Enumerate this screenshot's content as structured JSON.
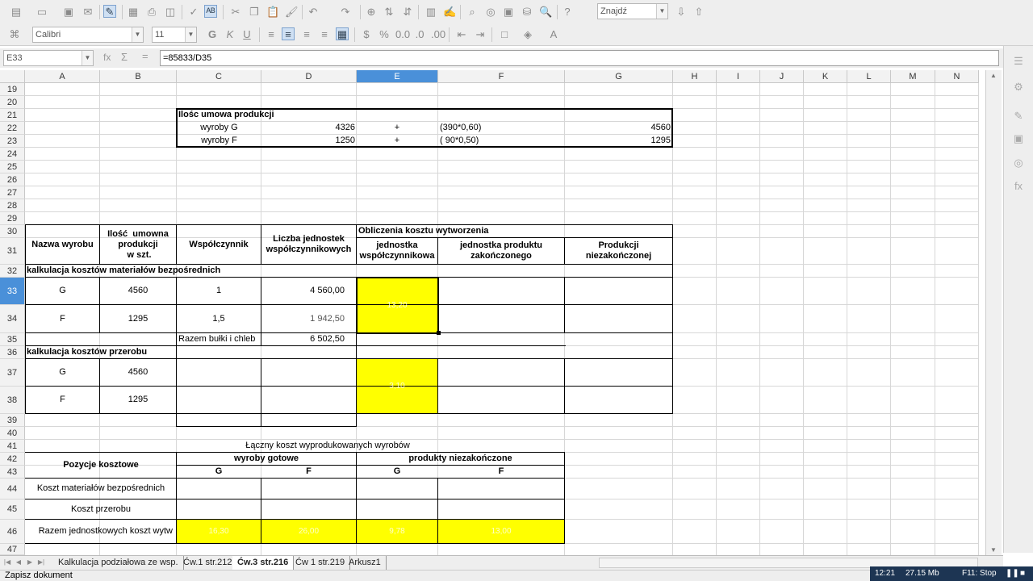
{
  "toolbar": {
    "font_name": "Calibri",
    "font_size": "11",
    "find_placeholder": "Znajdź"
  },
  "formula_bar": {
    "cell_ref": "E33",
    "formula": "=85833/D35"
  },
  "columns": [
    "A",
    "B",
    "C",
    "D",
    "E",
    "F",
    "G",
    "H",
    "I",
    "J",
    "K",
    "L",
    "M",
    "N"
  ],
  "selected_column": "E",
  "rows": [
    "19",
    "20",
    "21",
    "22",
    "23",
    "24",
    "25",
    "26",
    "27",
    "28",
    "29",
    "30",
    "31",
    "32",
    "33",
    "34",
    "35",
    "36",
    "37",
    "38",
    "39",
    "40",
    "41",
    "42",
    "43",
    "44",
    "45",
    "46",
    "47"
  ],
  "selected_row": "33",
  "cells": {
    "c21": "Ilośc umowa produkcji",
    "c22": "wyroby G",
    "d22": "4326",
    "e22": "+",
    "f22": "(390*0,60)",
    "g22": "4560",
    "c23": "wyroby F",
    "d23": "1250",
    "e23": "+",
    "f23": "( 90*0,50)",
    "g23": "1295",
    "a30": "Nazwa wyrobu",
    "b30": "Ilość  umowna produkcji\n w szt.",
    "c30": "Współczynnik",
    "d30": "Liczba jednostek współczynnikowych",
    "e30": "Obliczenia kosztu wytworzenia",
    "e31": "jednostka współczynnikowa",
    "f31": "jednostka produktu zakończonego",
    "g31": "Produkcji niezakończonej",
    "a32": "kalkulacja kosztów materiałów bezpośrednich",
    "a33": "G",
    "b33": "4560",
    "c33": "1",
    "d33": "4 560,00",
    "e33": "13,20",
    "a34": "F",
    "b34": "1295",
    "c34": "1,5",
    "d34": "1 942,50",
    "c35": "Razem bułki i chleb",
    "d35": "6 502,50",
    "a36": "kalkulacja kosztów przerobu",
    "a37": "G",
    "b37": "4560",
    "e37": "3,10",
    "a38": "F",
    "b38": "1295",
    "c41": "Łączny koszt wyprodukowanych wyrobów",
    "a42": "Pozycje kosztowe",
    "c42": "wyroby gotowe",
    "e42": "produkty niezakończone",
    "c43": "G",
    "d43": "F",
    "e43": "G",
    "f43": "F",
    "a44": "Koszt materiałów bezpośrednich",
    "a45": "Koszt przerobu",
    "a46": "Razem jednostkowych koszt wytw",
    "c46": "16,30",
    "d46": "26,00",
    "e46": "9,78",
    "f46": "13,00"
  },
  "sheet_tabs": [
    "Kalkulacja podziałowa ze wsp.",
    "Ćw.1 str.212",
    "Ćw.3 str.216",
    "Ćw 1 str.219",
    "Arkusz1"
  ],
  "active_tab": "Ćw.3 str.216",
  "status": {
    "message": "Zapisz dokument"
  },
  "system": {
    "time": "12:21",
    "memory": "27.15 Mb",
    "hint": "F11: Stop"
  },
  "colors": {
    "highlight": "#ffff00",
    "selection": "#4a90d9"
  }
}
